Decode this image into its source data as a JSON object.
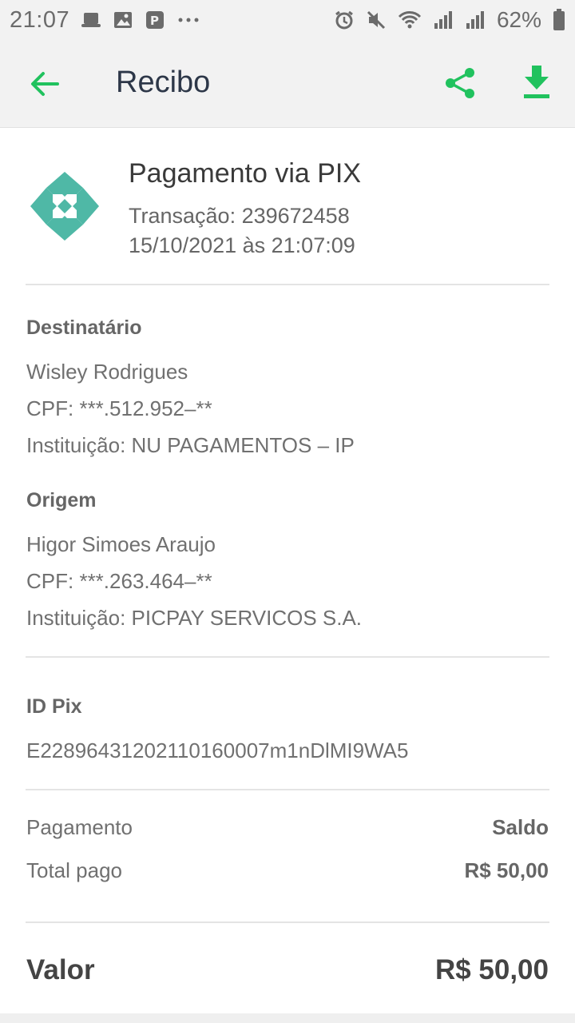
{
  "status_bar": {
    "time": "21:07",
    "battery_pct": "62%",
    "icons": [
      "hat-icon",
      "image-icon",
      "parking-icon",
      "more-icon",
      "alarm-icon",
      "mute-icon",
      "wifi-icon",
      "signal-icon",
      "signal-icon",
      "battery-icon"
    ]
  },
  "appbar": {
    "title": "Recibo",
    "accent_color": "#21c25e"
  },
  "header": {
    "title": "Pagamento via PIX",
    "transaction": "Transação: 239672458",
    "datetime": "15/10/2021 às 21:07:09"
  },
  "recipient": {
    "label": "Destinatário",
    "name": "Wisley Rodrigues",
    "cpf": "CPF: ***.512.952–**",
    "institution": "Instituição: NU PAGAMENTOS – IP"
  },
  "origin": {
    "label": "Origem",
    "name": "Higor Simoes Araujo",
    "cpf": "CPF: ***.263.464–**",
    "institution": "Instituição: PICPAY SERVICOS S.A."
  },
  "pix_id": {
    "label": "ID Pix",
    "value": "E22896431202110160007m1nDlMI9WA5"
  },
  "payment": {
    "method_label": "Pagamento",
    "method_value": "Saldo",
    "total_label": "Total pago",
    "total_value": "R$ 50,00"
  },
  "valor": {
    "label": "Valor",
    "value": "R$ 50,00"
  }
}
